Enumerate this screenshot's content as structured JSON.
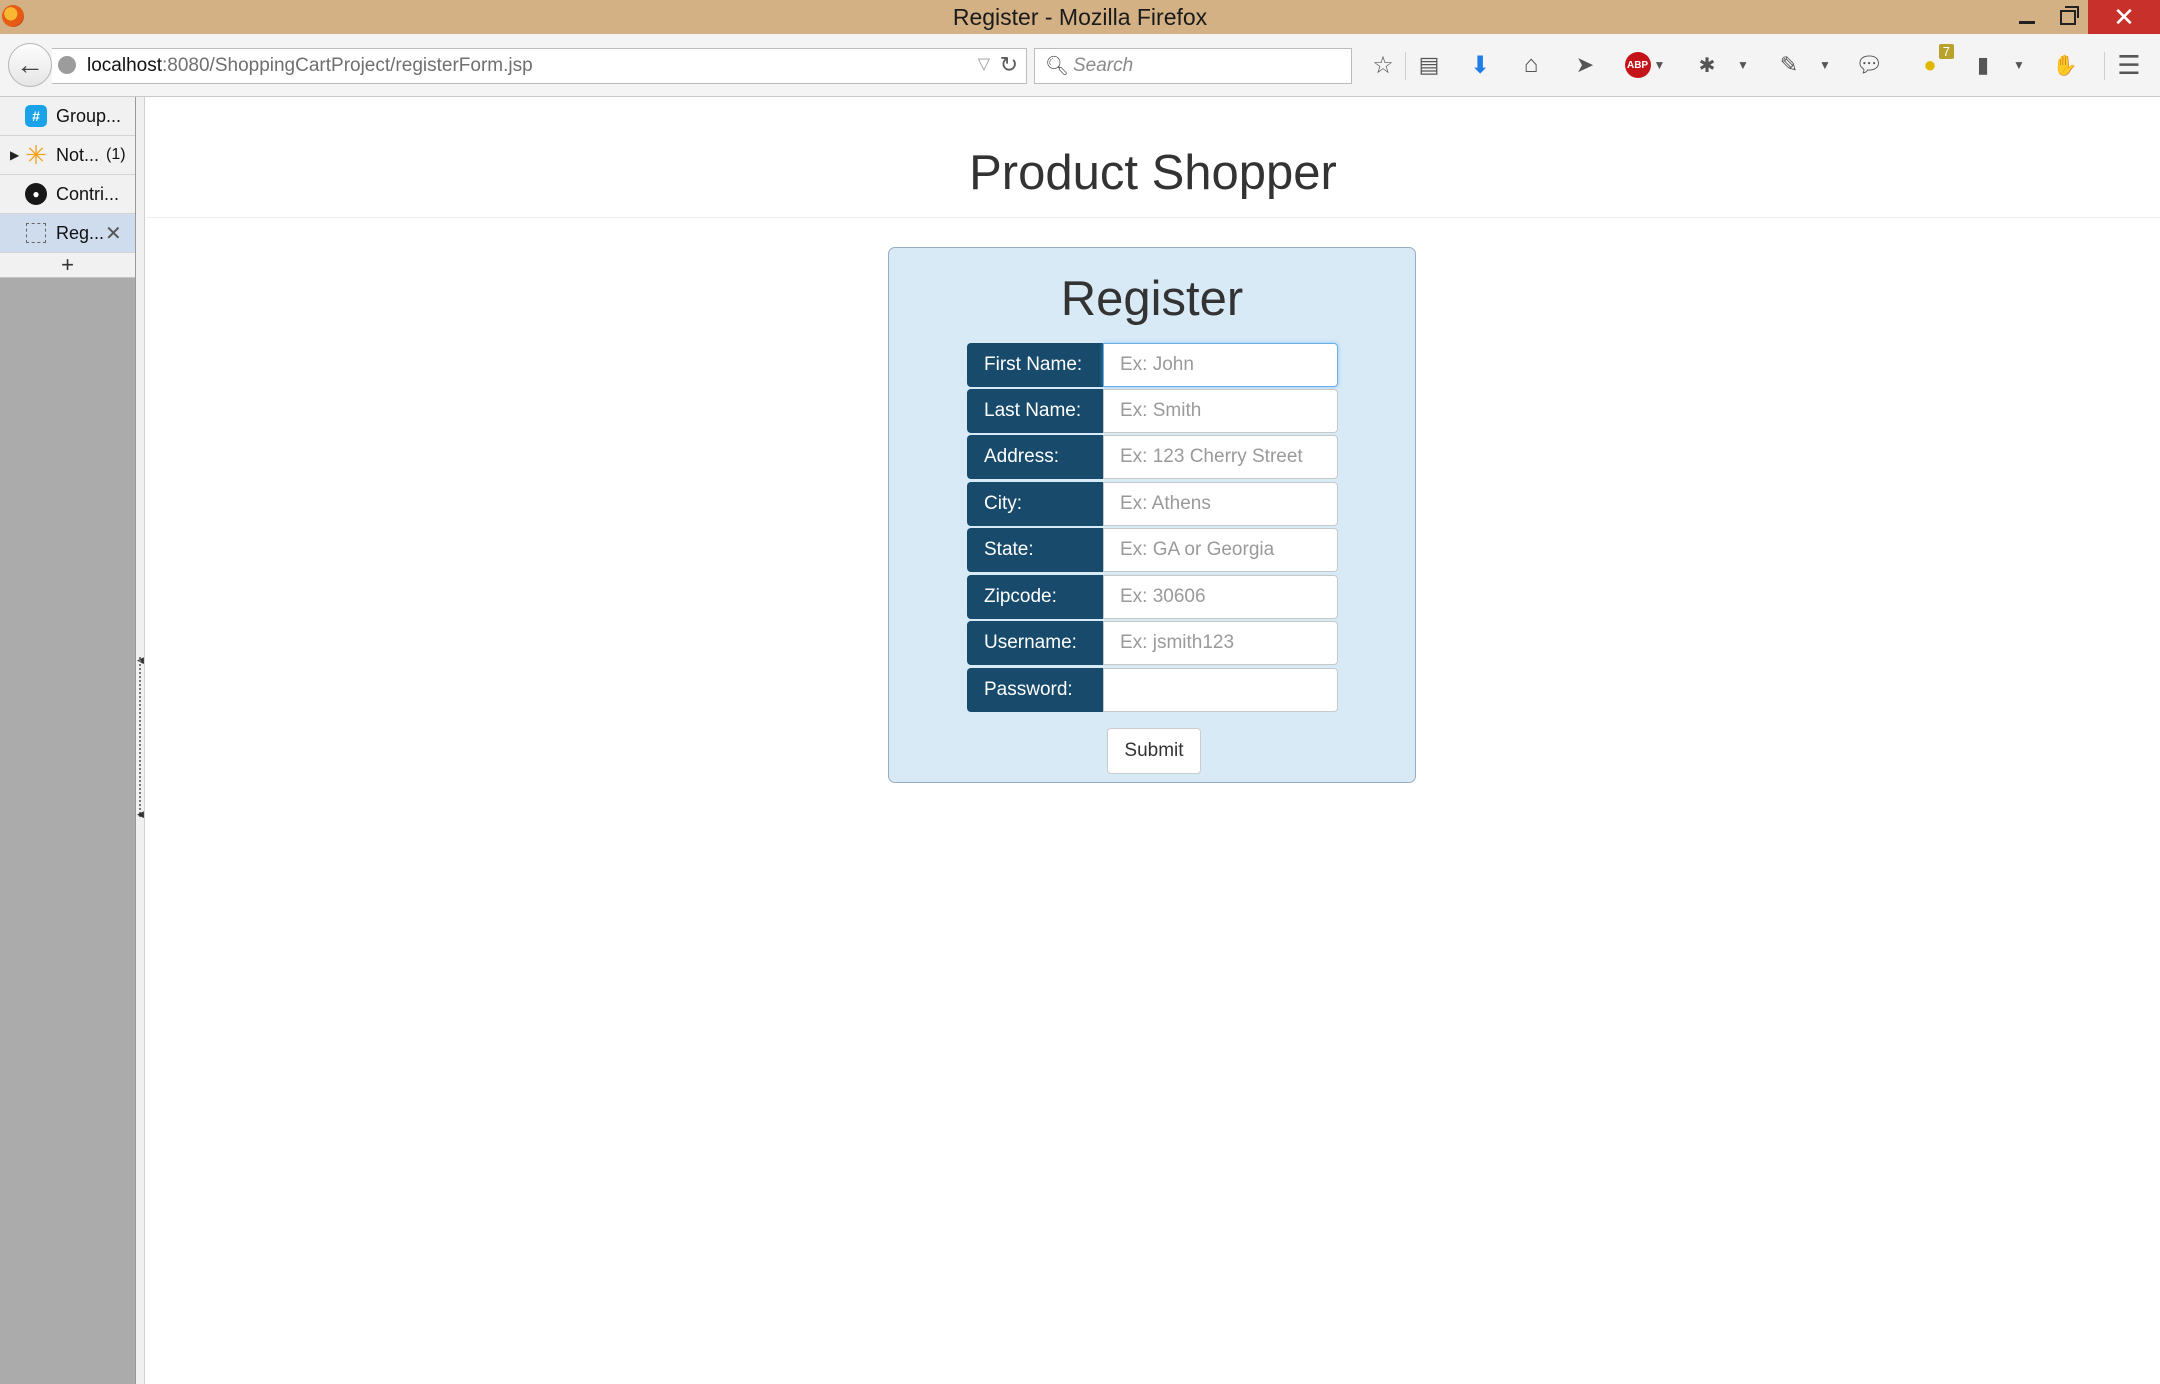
{
  "window": {
    "title": "Register - Mozilla Firefox"
  },
  "navbar": {
    "url_host": "localhost",
    "url_rest": ":8080/ShoppingCartProject/registerForm.jsp",
    "search_placeholder": "Search",
    "notification_count": "7"
  },
  "sidebar": {
    "tabs": [
      {
        "label": "Group...",
        "icon": "group-icon"
      },
      {
        "label": "Not...",
        "count": "(1)",
        "icon": "star-icon"
      },
      {
        "label": "Contri...",
        "icon": "github-icon"
      },
      {
        "label": "Reg...",
        "icon": "blank-page-icon",
        "active": true
      }
    ],
    "new_tab_label": "+"
  },
  "page": {
    "title": "Product Shopper",
    "form": {
      "title": "Register",
      "fields": [
        {
          "label": "First Name:",
          "placeholder": "Ex: John"
        },
        {
          "label": "Last Name:",
          "placeholder": "Ex: Smith"
        },
        {
          "label": "Address:",
          "placeholder": "Ex: 123 Cherry Street"
        },
        {
          "label": "City:",
          "placeholder": "Ex: Athens"
        },
        {
          "label": "State:",
          "placeholder": "Ex: GA or Georgia"
        },
        {
          "label": "Zipcode:",
          "placeholder": "Ex: 30606"
        },
        {
          "label": "Username:",
          "placeholder": "Ex: jsmith123"
        },
        {
          "label": "Password:",
          "placeholder": ""
        }
      ],
      "submit_label": "Submit"
    }
  },
  "colors": {
    "titlebar": "#d3b185",
    "label_bg": "#174a6b",
    "card_bg": "#d9eaf7",
    "close_button": "#c7302b"
  }
}
